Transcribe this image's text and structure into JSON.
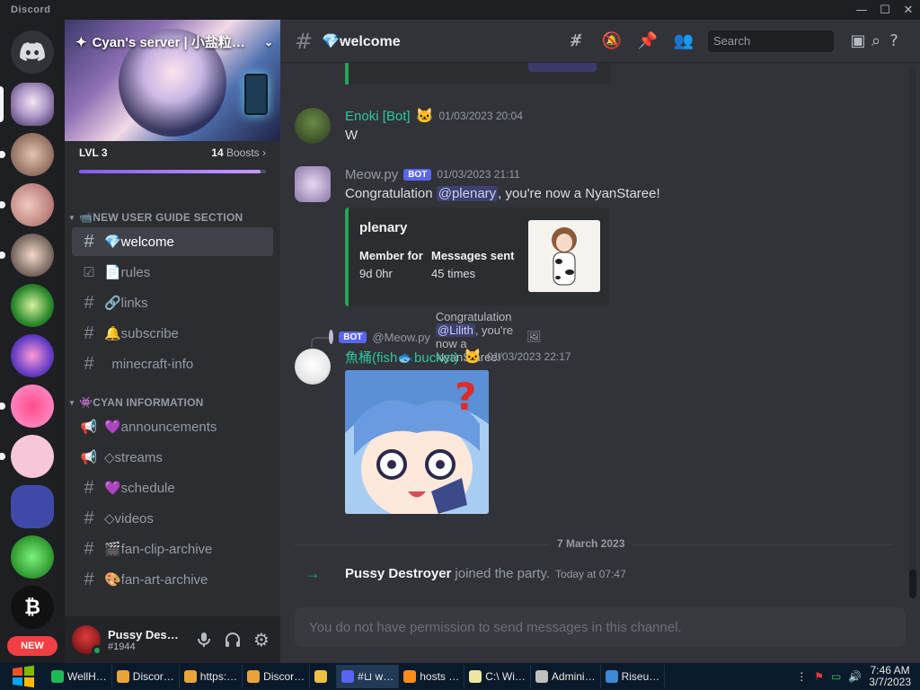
{
  "window": {
    "app_name": "Discord",
    "minimize": "—",
    "maximize": "☐",
    "close": "✕"
  },
  "rail": {
    "new_badge": "NEW"
  },
  "server": {
    "name": "Cyan's server | 小盐粒…",
    "level": "LVL 3",
    "boosts_count": "14",
    "boosts_label": "Boosts",
    "boost_progress": 0.97
  },
  "categories": [
    {
      "label": "📹NEW USER GUIDE SECTION"
    },
    {
      "label": "👾CYAN INFORMATION"
    }
  ],
  "channels_guide": [
    {
      "icon": "#",
      "name": "💎welcome",
      "active": true
    },
    {
      "icon": "☑",
      "name": "📄rules"
    },
    {
      "icon": "#",
      "name": "🔗links"
    },
    {
      "icon": "#",
      "name": "🔔subscribe"
    },
    {
      "icon": "#",
      "name": "  minecraft-info"
    }
  ],
  "channels_info": [
    {
      "icon": "📢",
      "name": "💜announcements"
    },
    {
      "icon": "📢",
      "name": "◇streams"
    },
    {
      "icon": "#",
      "name": "💜schedule"
    },
    {
      "icon": "#",
      "name": "◇videos"
    },
    {
      "icon": "#",
      "name": "🎬fan-clip-archive"
    },
    {
      "icon": "#",
      "name": "🎨fan-art-archive"
    }
  ],
  "user": {
    "name": "Pussy Des…",
    "tag": "#1944"
  },
  "header": {
    "channel": "💎welcome",
    "search_placeholder": "Search"
  },
  "messages": {
    "enoki": {
      "author": "Enoki [Bot]",
      "emoji": "🐱",
      "time": "01/03/2023 20:04",
      "text": "W",
      "color": "#2dc5a0"
    },
    "meow": {
      "author": "Meow.py",
      "badge": "BOT",
      "time": "01/03/2023 21:11",
      "text_before": "Congratulation ",
      "mention": "@plenary",
      "text_after": ", you're now a NyanStaree!",
      "embed": {
        "title": "plenary",
        "field1_name": "Member for",
        "field1_value": "9d 0hr",
        "field2_name": "Messages sent",
        "field2_value": "45 times"
      }
    },
    "fish": {
      "reply_badge": "BOT",
      "reply_author": "@Meow.py",
      "reply_text_before": "Congratulation ",
      "reply_mention": "@Lilith",
      "reply_text_after": ", you're now a NyanStaree!",
      "author": "魚桶(fish🐟bucket)",
      "emoji": "🐱",
      "time": "01/03/2023 22:17",
      "color": "#2dc5a0"
    }
  },
  "date_divider": "7 March 2023",
  "join": {
    "name": "Pussy Destroyer",
    "text": "joined the party.",
    "time": "Today at 07:47"
  },
  "composer": {
    "placeholder": "You do not have permission to send messages in this channel."
  },
  "taskbar": {
    "apps": [
      {
        "label": "WellH…",
        "color": "#1db954"
      },
      {
        "label": "Discor…",
        "color": "#e8a33a"
      },
      {
        "label": "https:…",
        "color": "#e8a33a"
      },
      {
        "label": "Discor…",
        "color": "#e8a33a"
      },
      {
        "label": "",
        "color": "#f0c040"
      },
      {
        "label": "#⊔ w…",
        "color": "#5865f2",
        "active": true
      },
      {
        "label": "hosts …",
        "color": "#ff8c1a"
      },
      {
        "label": "C:\\ Wi…",
        "color": "#ece6a0"
      },
      {
        "label": "Admini…",
        "color": "#c0c0c0"
      },
      {
        "label": "Riseu…",
        "color": "#3a8ad6"
      }
    ],
    "time": "7:46 AM",
    "date": "3/7/2023"
  }
}
